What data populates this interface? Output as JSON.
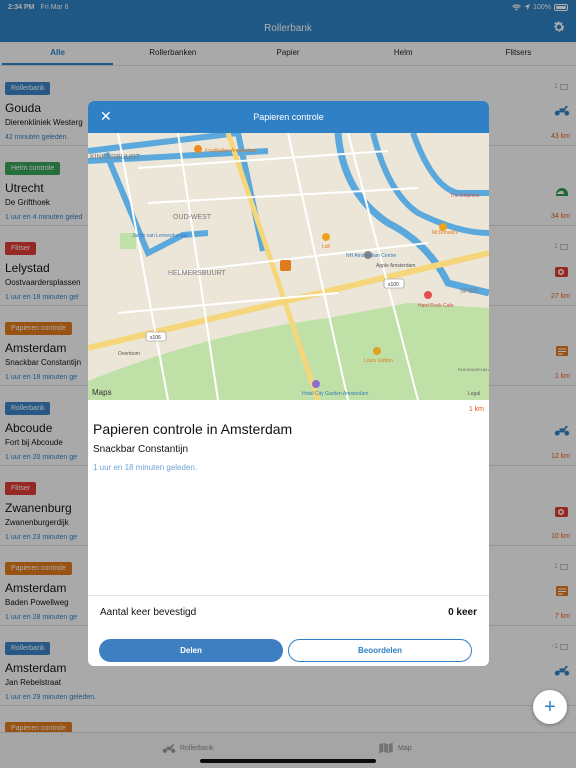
{
  "status": {
    "time": "2:34 PM",
    "date": "Fri Mar 6",
    "battery": "100%"
  },
  "navbar": {
    "title": "Rollerbank"
  },
  "tabs": [
    "Alle",
    "Rollerbanken",
    "Papier",
    "Helm",
    "Flitsers"
  ],
  "rows": [
    {
      "badge": "Rollerbank",
      "type": "rollerbank",
      "city": "Gouda",
      "street": "Dierenkliniek Westerg",
      "time": "42 minuten geleden.",
      "count": "1",
      "distance": "43 km",
      "icon": "scooter-icon"
    },
    {
      "badge": "Helm controle",
      "type": "helm",
      "city": "Utrecht",
      "street": "De Grifthoek",
      "time": "1 uur en 4 minuten geled",
      "count": "",
      "distance": "34 km",
      "icon": "helmet-icon"
    },
    {
      "badge": "Flitser",
      "type": "flitser",
      "city": "Lelystad",
      "street": "Oostvaardersplassen",
      "time": "1 uur en 18 minuten gel",
      "count": "1",
      "distance": "27 km",
      "icon": "camera-icon"
    },
    {
      "badge": "Papieren controle",
      "type": "papier",
      "city": "Amsterdam",
      "street": "Snackbar Constantijn",
      "time": "1 uur en 18 minuten ge",
      "count": "",
      "distance": "1 km",
      "icon": "document-icon"
    },
    {
      "badge": "Rollerbank",
      "type": "rollerbank",
      "city": "Abcoude",
      "street": "Fort bij Abcoude",
      "time": "1 uur en 20 minuten ge",
      "count": "",
      "distance": "12 km",
      "icon": "scooter-icon"
    },
    {
      "badge": "Flitser",
      "type": "flitser",
      "city": "Zwanenburg",
      "street": "Zwanenburgerdijk",
      "time": "1 uur en 23 minuten ge",
      "count": "",
      "distance": "10 km",
      "icon": "camera-icon"
    },
    {
      "badge": "Papieren controle",
      "type": "papier",
      "city": "Amsterdam",
      "street": "Baden Powellweg",
      "time": "1 uur en 28 minuten ge",
      "count": "1",
      "distance": "7 km",
      "icon": "document-icon"
    },
    {
      "badge": "Rollerbank",
      "type": "rollerbank",
      "city": "Amsterdam",
      "street": "Jan Rebelstraat",
      "time": "1 uur en 29 minuten geleden.",
      "count": "-1",
      "distance": "",
      "icon": "scooter-icon"
    },
    {
      "badge": "Papieren controle",
      "type": "papier",
      "city": "",
      "street": "",
      "time": "",
      "count": "",
      "distance": "",
      "icon": ""
    }
  ],
  "bottom": {
    "rollerbank": "Rollerbank",
    "map": "Map"
  },
  "fab": {
    "label": "+"
  },
  "modal": {
    "title": "Papieren controle",
    "close": "✕",
    "distance": "1 km",
    "heading": "Papieren controle in Amsterdam",
    "street": "Snackbar Constantijn",
    "time": "1 uur en 18 minuten geleden.",
    "confirmed_label": "Aantal keer bevestigd",
    "confirmed_value": "0 keer",
    "share": "Delen",
    "rate": "Beoordelen",
    "map": {
      "attribution": "Maps",
      "labels": [
        "KINKERBUURT",
        "OUD-WEST",
        "HELMERSBUURT",
        "Foodhallen Amsterdam",
        "Jacob van Lennepkanaal",
        "Lidl",
        "NH Amsterdam Centre",
        "Apple Amsterdam",
        "McDonald's",
        "The Dolphins",
        "Hard Rock Cafe",
        "Louis Vuitton",
        "Hotel City Garden Amsterdam",
        "RIJKSMUSEUM AMSTERDAM",
        "s100",
        "s106",
        "Overtoom",
        "SPIEG",
        "Legal"
      ]
    }
  },
  "colors": {
    "primary": "#2f80c4",
    "rollerbank": "#3b84c6",
    "helm": "#3aa35a",
    "flitser": "#dc3b33",
    "papier": "#e07a1c",
    "distance": "#e05a10"
  }
}
